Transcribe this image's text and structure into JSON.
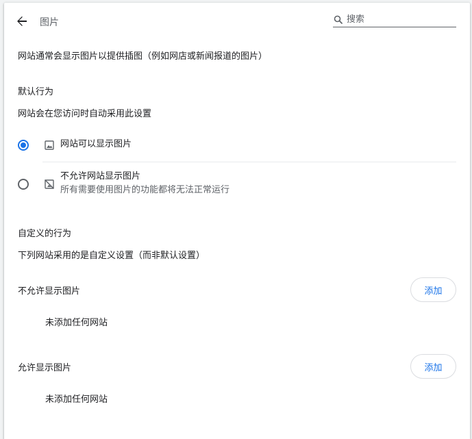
{
  "header": {
    "title": "图片",
    "search_placeholder": "搜索"
  },
  "description": "网站通常会显示图片以提供插图（例如网店或新闻报道的图片）",
  "default_behavior": {
    "heading": "默认行为",
    "subheading": "网站会在您访问时自动采用此设置",
    "options": [
      {
        "label": "网站可以显示图片",
        "sublabel": "",
        "selected": true,
        "icon": "image-icon"
      },
      {
        "label": "不允许网站显示图片",
        "sublabel": "所有需要使用图片的功能都将无法正常运行",
        "selected": false,
        "icon": "image-off-icon"
      }
    ]
  },
  "custom_behavior": {
    "heading": "自定义的行为",
    "subheading": "下列网站采用的是自定义设置（而非默认设置）",
    "blocked": {
      "label": "不允许显示图片",
      "add_label": "添加",
      "empty_text": "未添加任何网站"
    },
    "allowed": {
      "label": "允许显示图片",
      "add_label": "添加",
      "empty_text": "未添加任何网站"
    }
  },
  "colors": {
    "accent": "#1a73e8",
    "text": "#202124",
    "secondary": "#5f6368"
  }
}
